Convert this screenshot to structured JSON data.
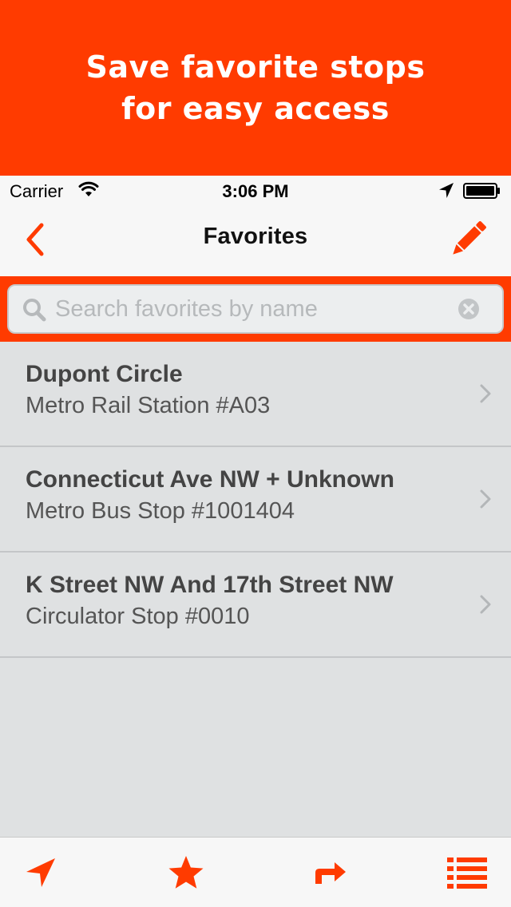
{
  "promo": {
    "line1": "Save favorite stops",
    "line2": "for easy access"
  },
  "status_bar": {
    "carrier": "Carrier",
    "time": "3:06 PM",
    "icons": [
      "wifi-icon",
      "location-arrow-icon",
      "battery-icon"
    ]
  },
  "nav": {
    "title": "Favorites",
    "back_icon": "chevron-left-icon",
    "edit_icon": "pencil-icon"
  },
  "search": {
    "placeholder": "Search favorites by name",
    "value": ""
  },
  "favorites": [
    {
      "name": "Dupont Circle",
      "subtitle": "Metro Rail Station #A03"
    },
    {
      "name": "Connecticut Ave NW + Unknown",
      "subtitle": "Metro Bus Stop #1001404"
    },
    {
      "name": "K Street NW And 17th Street NW",
      "subtitle": "Circulator Stop #0010"
    }
  ],
  "tab_bar": {
    "tabs": [
      {
        "icon": "location-arrow-icon"
      },
      {
        "icon": "star-icon"
      },
      {
        "icon": "directions-arrow-icon"
      },
      {
        "icon": "list-icon"
      }
    ]
  },
  "colors": {
    "accent": "#ff3b00",
    "background": "#dfe1e2",
    "bar": "#f7f7f7"
  }
}
